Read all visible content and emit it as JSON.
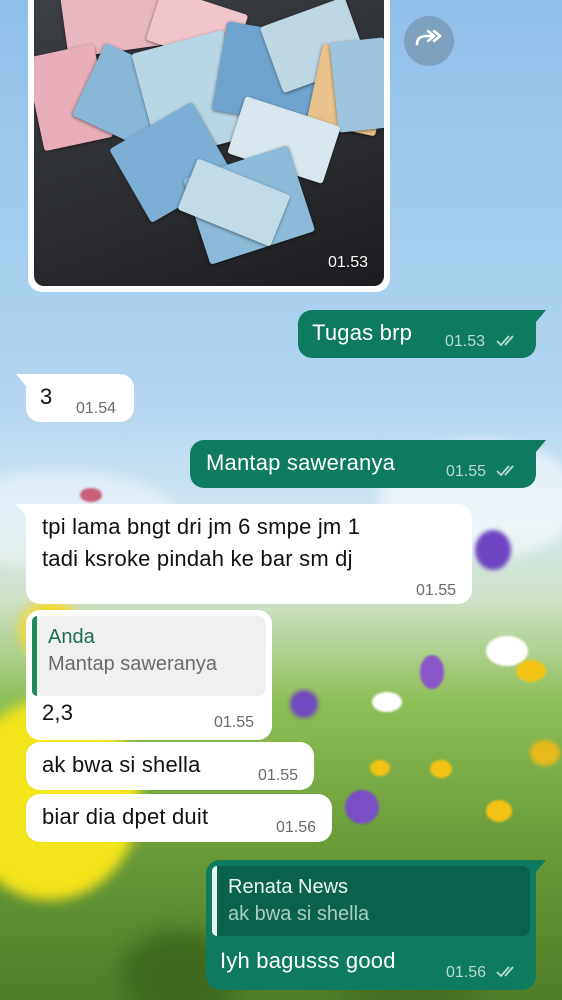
{
  "image_message": {
    "time": "01.53"
  },
  "messages": [
    {
      "side": "out",
      "text": "Tugas brp",
      "time": "01.53"
    },
    {
      "side": "in",
      "text": "3",
      "time": "01.54"
    },
    {
      "side": "out",
      "text": "Mantap saweranya",
      "time": "01.55"
    },
    {
      "side": "in",
      "line1": "tpi lama bngt dri jm 6 smpe jm 1",
      "line2": "tadi ksroke pindah ke bar sm dj",
      "time": "01.55"
    },
    {
      "side": "in",
      "quote_name": "Anda",
      "quote_text": "Mantap saweranya",
      "text": "2,3",
      "time": "01.55"
    },
    {
      "side": "in",
      "text": "ak bwa si shella",
      "time": "01.55"
    },
    {
      "side": "in",
      "text": "biar dia dpet duit",
      "time": "01.56"
    },
    {
      "side": "out",
      "quote_name": "Renata News",
      "quote_text": "ak bwa si shella",
      "text": "Iyh bagusss good",
      "time": "01.56"
    }
  ],
  "colors": {
    "outgoing_bubble": "#0e7a5f",
    "incoming_bubble": "#ffffff",
    "read_ticks": "#b8dccf"
  },
  "icons": {
    "forward": "forward-share-icon",
    "ticks": "double-check-icon"
  }
}
